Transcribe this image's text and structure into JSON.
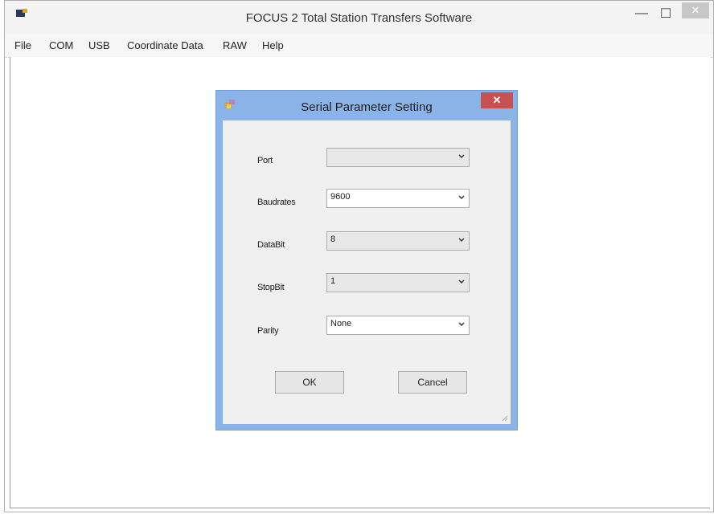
{
  "window": {
    "title": "FOCUS 2 Total Station Transfers Software",
    "minimize_glyph": "—",
    "maximize_glyph": "☐",
    "close_glyph": "✕"
  },
  "menu": [
    "File",
    "COM",
    "USB",
    "Coordinate Data",
    "RAW",
    "Help"
  ],
  "dialog": {
    "title": "Serial Parameter Setting",
    "close_glyph": "✕",
    "fields": [
      {
        "label": "Port",
        "value": ""
      },
      {
        "label": "Baudrates",
        "value": "9600"
      },
      {
        "label": "DataBit",
        "value": "8"
      },
      {
        "label": "StopBit",
        "value": "1"
      },
      {
        "label": "Parity",
        "value": "None"
      }
    ],
    "ok_label": "OK",
    "cancel_label": "Cancel"
  },
  "colors": {
    "dialog_frame": "#8ab4e8",
    "dialog_close": "#c75050",
    "dialog_body": "#f0f0f0"
  }
}
